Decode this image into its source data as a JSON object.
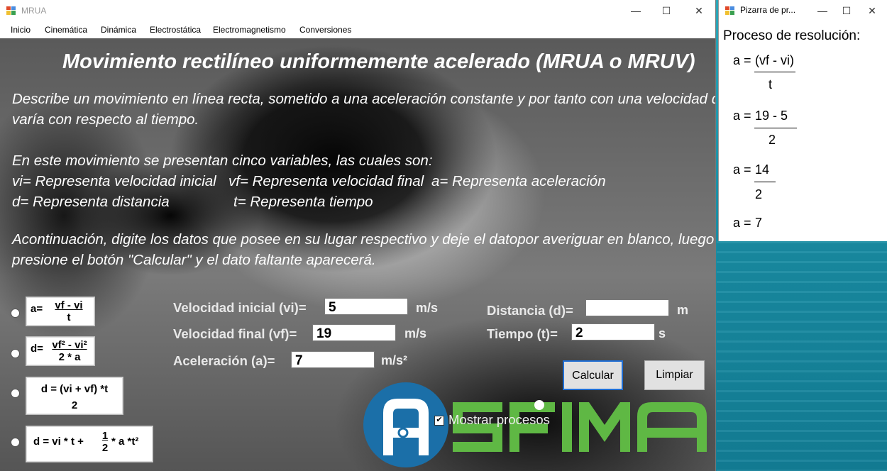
{
  "main_window": {
    "title": "MRUA",
    "controls": {
      "minimize": "—",
      "maximize": "☐",
      "close": "✕"
    },
    "menu": [
      "Inicio",
      "Cinemática",
      "Dinámica",
      "Electrostática",
      "Electromagnetismo",
      "Conversiones"
    ]
  },
  "content": {
    "heading": "Movimiento rectilíneo uniformemente acelerado (MRUA o MRUV)",
    "description": [
      "Describe un movimiento en línea recta, sometido a una aceleración constante y por tanto con una velocidad que",
      "varía con respecto al tiempo."
    ],
    "variables_intro": "En este movimiento se presentan cinco variables, las cuales son:",
    "variables": [
      "vi= Representa velocidad inicial",
      "vf= Representa velocidad final",
      "a= Representa aceleración",
      "d= Representa distancia",
      "t= Representa tiempo"
    ],
    "instructions": [
      "Acontinuación, digite los datos que posee en su lugar respectivo y  deje el datopor averiguar en blanco, luego",
      "presione  el botón \"Calcular\" y el dato faltante aparecerá."
    ]
  },
  "formulas": [
    {
      "prefix": "a=",
      "numerator": "vf - vi",
      "denominator": "t"
    },
    {
      "prefix": "d=",
      "numerator": "vf² - vi²",
      "denominator": "2 * a"
    },
    {
      "numerator": "d = (vi + vf) *t",
      "denominator": "2"
    },
    {
      "text": "d = vi * t + ",
      "frac_num": "1",
      "frac_den": "2",
      "suffix": "* a *t²"
    }
  ],
  "fields": {
    "vi": {
      "label": "Velocidad inicial (vi)=",
      "value": "5",
      "unit": "m/s"
    },
    "vf": {
      "label": "Velocidad final (vf)=",
      "value": "19",
      "unit": "m/s"
    },
    "a": {
      "label": "Aceleración (a)=",
      "value": "7",
      "unit": "m/s²"
    },
    "d": {
      "label": "Distancia (d)=",
      "value": "",
      "unit": "m"
    },
    "t": {
      "label": "Tiempo (t)=",
      "value": "2",
      "unit": "s"
    }
  },
  "show_process": {
    "label": "Mostrar procesos",
    "checked": true,
    "mark": "✔"
  },
  "buttons": {
    "calculate": "Calcular",
    "clear": "Limpiar"
  },
  "logo": {
    "text": "ASFIMA",
    "colors": {
      "circle": "#1b6fa8",
      "letters": "#5fb844"
    }
  },
  "side_window": {
    "title": "Pizarra de pr...",
    "heading": "Proceso de resolución:",
    "steps": [
      {
        "lhs": "a =",
        "num": "(vf - vi)",
        "den": "t"
      },
      {
        "lhs": "a =",
        "num": "19 - 5",
        "den": "2"
      },
      {
        "lhs": "a =",
        "num": "14",
        "den": "2"
      },
      {
        "lhs": "a =",
        "num": "7",
        "den": ""
      }
    ]
  }
}
